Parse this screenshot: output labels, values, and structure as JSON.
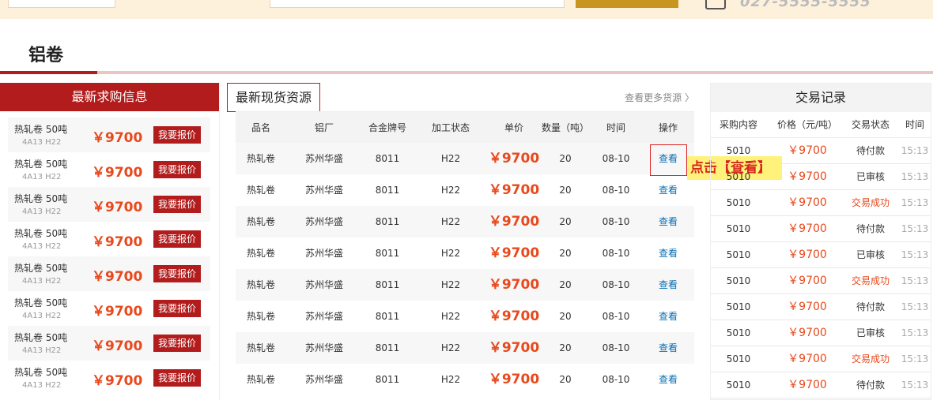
{
  "header": {
    "phone": "027-5555-5555"
  },
  "section": {
    "title": "铝卷"
  },
  "buy": {
    "title": "最新求购信息",
    "items": [
      {
        "name": "热轧卷 50吨",
        "spec": "4A13 H22",
        "price": "￥9700",
        "button": "我要报价"
      },
      {
        "name": "热轧卷 50吨",
        "spec": "4A13 H22",
        "price": "￥9700",
        "button": "我要报价"
      },
      {
        "name": "热轧卷 50吨",
        "spec": "4A13 H22",
        "price": "￥9700",
        "button": "我要报价"
      },
      {
        "name": "热轧卷 50吨",
        "spec": "4A13 H22",
        "price": "￥9700",
        "button": "我要报价"
      },
      {
        "name": "热轧卷 50吨",
        "spec": "4A13 H22",
        "price": "￥9700",
        "button": "我要报价"
      },
      {
        "name": "热轧卷 50吨",
        "spec": "4A13 H22",
        "price": "￥9700",
        "button": "我要报价"
      },
      {
        "name": "热轧卷 50吨",
        "spec": "4A13 H22",
        "price": "￥9700",
        "button": "我要报价"
      },
      {
        "name": "热轧卷 50吨",
        "spec": "4A13 H22",
        "price": "￥9700",
        "button": "我要报价"
      }
    ]
  },
  "stock": {
    "title": "最新现货资源",
    "more": "查看更多货源 〉",
    "columns": [
      "品名",
      "铝厂",
      "合金牌号",
      "加工状态",
      "单价",
      "数量（吨）",
      "时间",
      "操作"
    ],
    "rows": [
      {
        "name": "热轧卷",
        "factory": "苏州华盛",
        "alloy": "8011",
        "state": "H22",
        "price": "￥9700",
        "qty": "20",
        "date": "08-10",
        "action": "查看"
      },
      {
        "name": "热轧卷",
        "factory": "苏州华盛",
        "alloy": "8011",
        "state": "H22",
        "price": "￥9700",
        "qty": "20",
        "date": "08-10",
        "action": "查看"
      },
      {
        "name": "热轧卷",
        "factory": "苏州华盛",
        "alloy": "8011",
        "state": "H22",
        "price": "￥9700",
        "qty": "20",
        "date": "08-10",
        "action": "查看"
      },
      {
        "name": "热轧卷",
        "factory": "苏州华盛",
        "alloy": "8011",
        "state": "H22",
        "price": "￥9700",
        "qty": "20",
        "date": "08-10",
        "action": "查看"
      },
      {
        "name": "热轧卷",
        "factory": "苏州华盛",
        "alloy": "8011",
        "state": "H22",
        "price": "￥9700",
        "qty": "20",
        "date": "08-10",
        "action": "查看"
      },
      {
        "name": "热轧卷",
        "factory": "苏州华盛",
        "alloy": "8011",
        "state": "H22",
        "price": "￥9700",
        "qty": "20",
        "date": "08-10",
        "action": "查看"
      },
      {
        "name": "热轧卷",
        "factory": "苏州华盛",
        "alloy": "8011",
        "state": "H22",
        "price": "￥9700",
        "qty": "20",
        "date": "08-10",
        "action": "查看"
      },
      {
        "name": "热轧卷",
        "factory": "苏州华盛",
        "alloy": "8011",
        "state": "H22",
        "price": "￥9700",
        "qty": "20",
        "date": "08-10",
        "action": "查看"
      }
    ],
    "callout": "点击【查看】"
  },
  "trades": {
    "title": "交易记录",
    "columns": [
      "采购内容",
      "价格（元/吨）",
      "交易状态",
      "时间"
    ],
    "rows": [
      {
        "content": "5010",
        "price": "￥9700",
        "status": "待付款",
        "time": "15:13",
        "done": false
      },
      {
        "content": "5010",
        "price": "￥9700",
        "status": "已审核",
        "time": "15:13",
        "done": false
      },
      {
        "content": "5010",
        "price": "￥9700",
        "status": "交易成功",
        "time": "15:13",
        "done": true
      },
      {
        "content": "5010",
        "price": "￥9700",
        "status": "待付款",
        "time": "15:13",
        "done": false
      },
      {
        "content": "5010",
        "price": "￥9700",
        "status": "已审核",
        "time": "15:13",
        "done": false
      },
      {
        "content": "5010",
        "price": "￥9700",
        "status": "交易成功",
        "time": "15:13",
        "done": true
      },
      {
        "content": "5010",
        "price": "￥9700",
        "status": "待付款",
        "time": "15:13",
        "done": false
      },
      {
        "content": "5010",
        "price": "￥9700",
        "status": "已审核",
        "time": "15:13",
        "done": false
      },
      {
        "content": "5010",
        "price": "￥9700",
        "status": "交易成功",
        "time": "15:13",
        "done": true
      },
      {
        "content": "5010",
        "price": "￥9700",
        "status": "待付款",
        "time": "15:13",
        "done": false
      }
    ]
  },
  "colors": {
    "brand_red": "#b21c1c",
    "price_orange": "#e8491d",
    "link_blue": "#0a6fb2",
    "callout_bg": "#fff27a"
  }
}
